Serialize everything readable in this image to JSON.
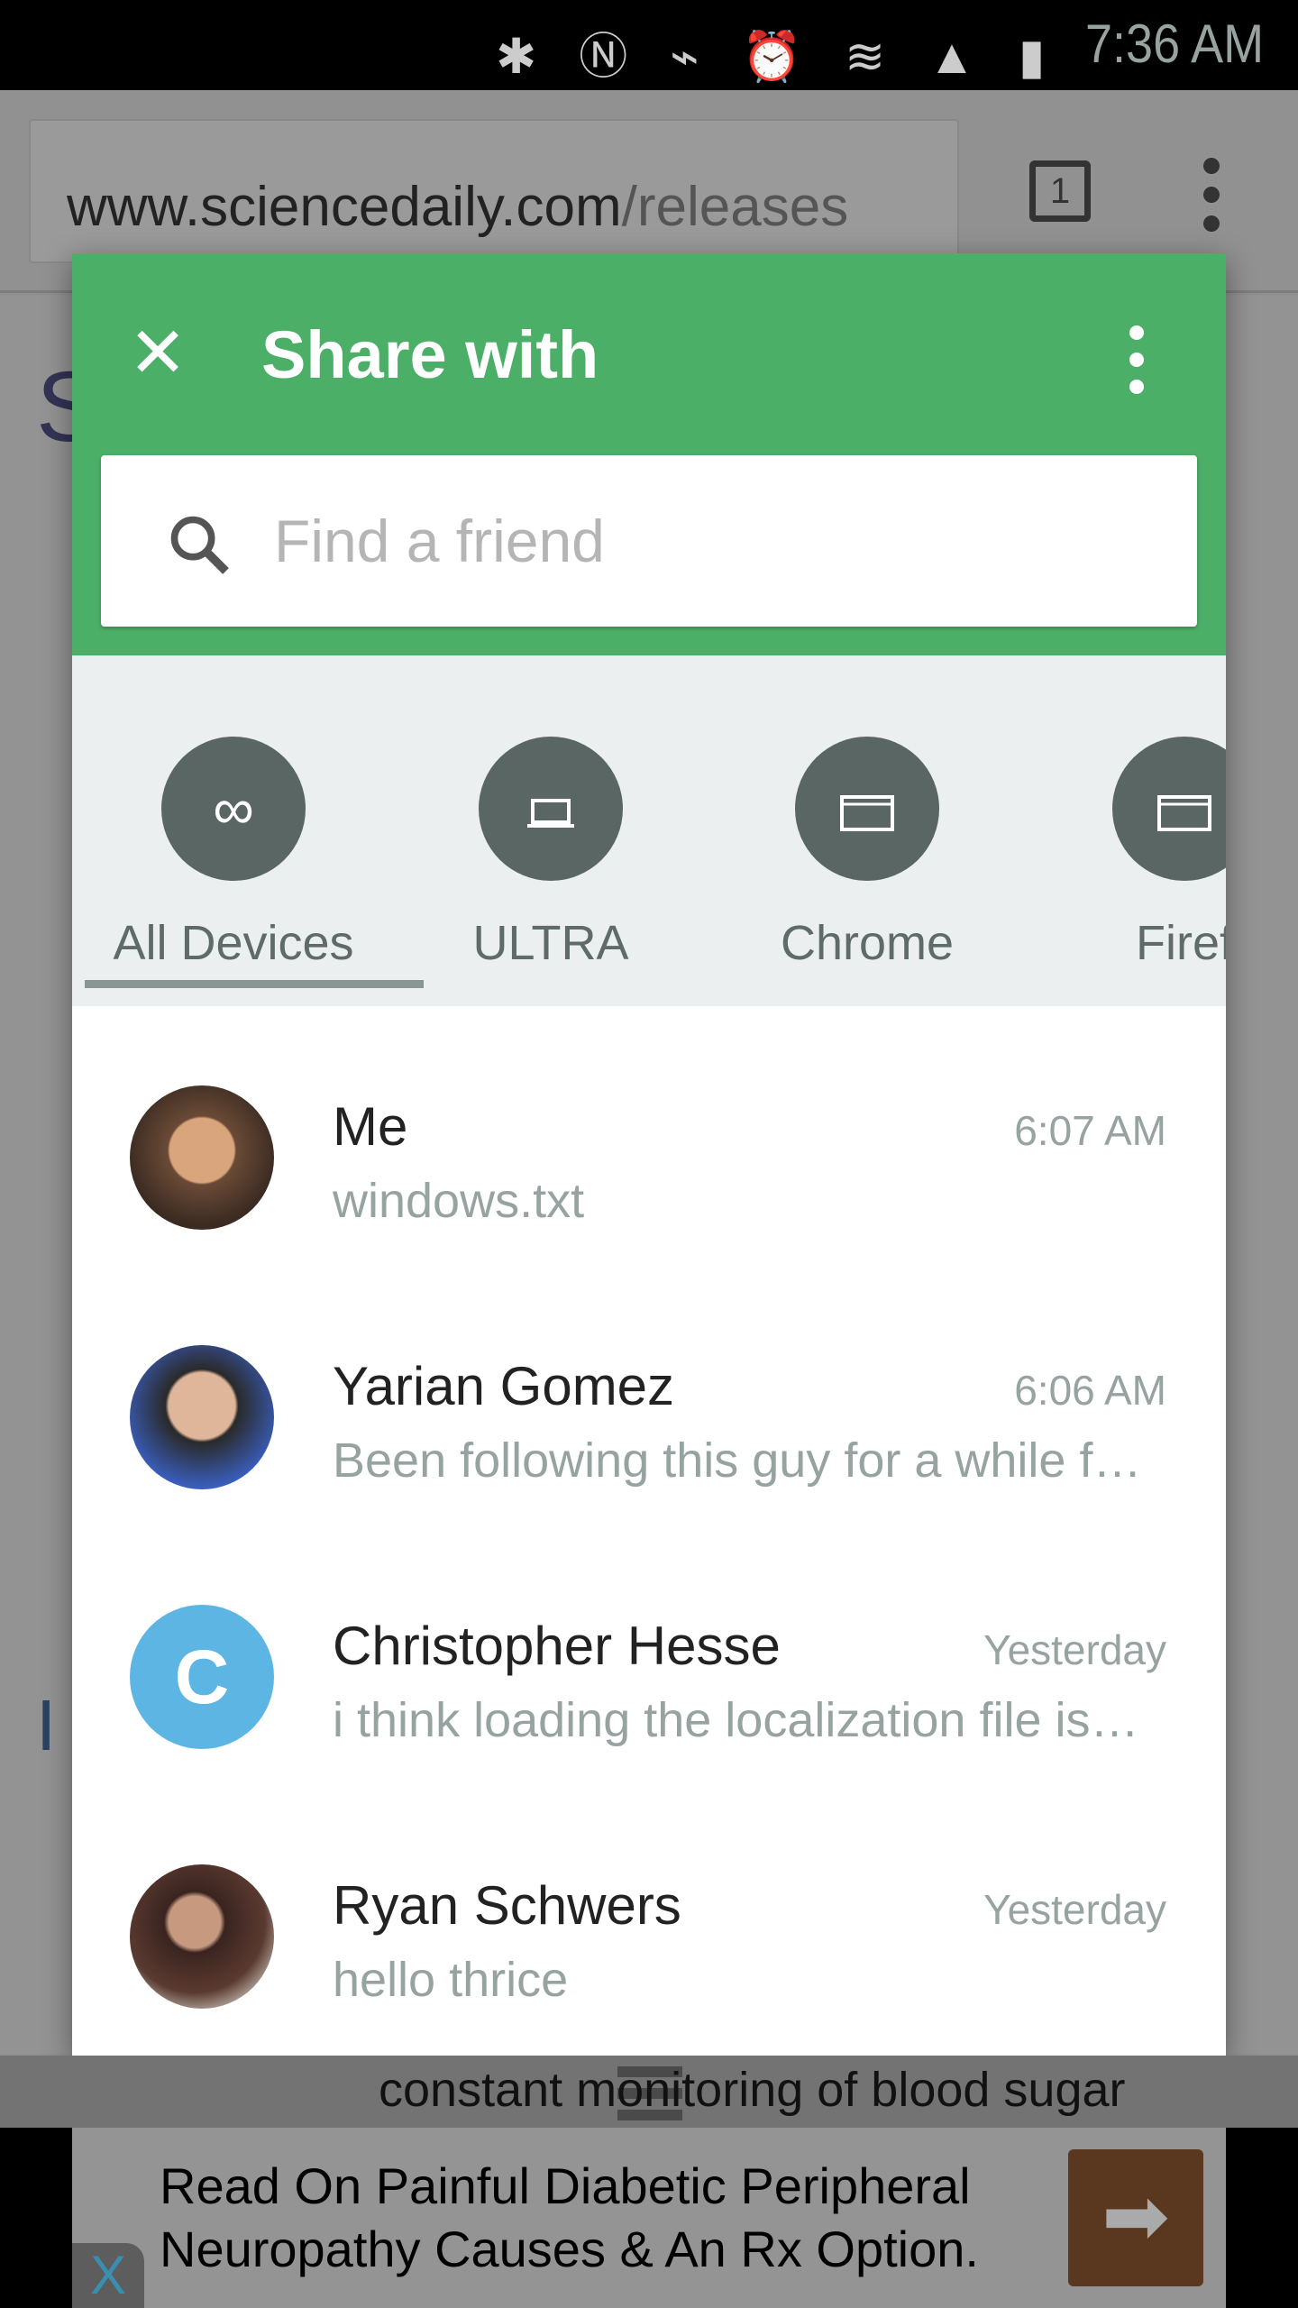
{
  "status_bar": {
    "time": "7:36 AM",
    "icons": [
      "bluetooth-icon",
      "nfc-icon",
      "vibrate-icon",
      "alarm-icon",
      "wifi-icon",
      "4g-lte-icon",
      "signal-icon",
      "battery-charging-icon"
    ]
  },
  "browser": {
    "url_host": "www.sciencedaily.com",
    "url_path": "/releases",
    "tab_count": "1"
  },
  "share_dialog": {
    "title": "Share with",
    "search_placeholder": "Find a friend",
    "accent_color": "#4caf67",
    "devices": [
      {
        "label": "All Devices",
        "icon": "infinity-icon",
        "selected": true
      },
      {
        "label": "ULTRA",
        "icon": "laptop-icon"
      },
      {
        "label": "Chrome",
        "icon": "browser-window-icon"
      },
      {
        "label": "Firef",
        "icon": "browser-window-icon"
      }
    ],
    "conversations": [
      {
        "name": "Me",
        "time": "6:07 AM",
        "message": "windows.txt"
      },
      {
        "name": "Yarian Gomez",
        "time": "6:06 AM",
        "message": "Been following this guy for a while f…"
      },
      {
        "name": "Christopher Hesse",
        "time": "Yesterday",
        "message": "i think loading the localization file is…",
        "initial": "C"
      },
      {
        "name": "Ryan Schwers",
        "time": "Yesterday",
        "message": "hello thrice"
      }
    ]
  },
  "background_page": {
    "partial_text": "constant monitoring of blood sugar"
  },
  "ad": {
    "text": "Read On Painful Diabetic Peripheral Neuropathy Causes & An Rx Option.",
    "close": "X"
  }
}
